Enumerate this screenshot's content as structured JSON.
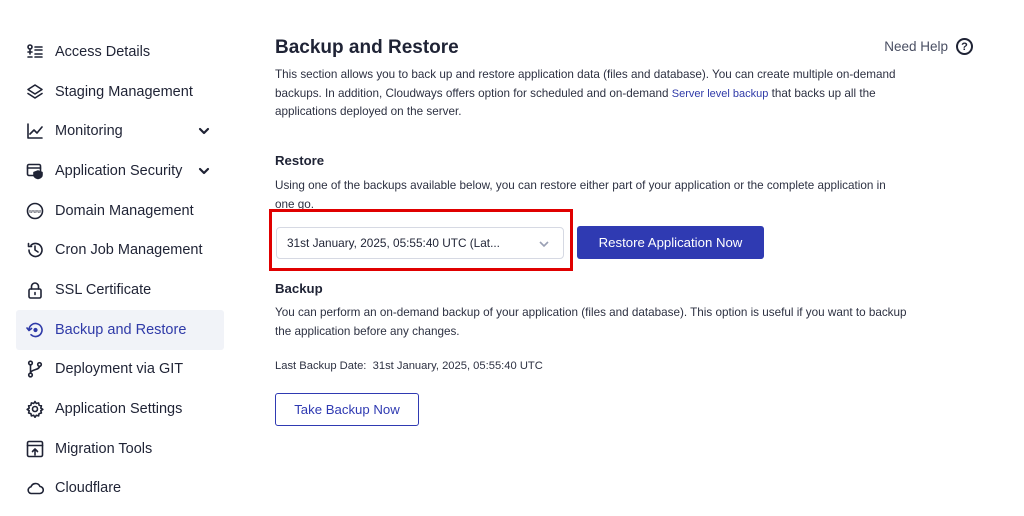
{
  "sidebar": {
    "items": [
      {
        "label": "Access Details",
        "icon": "access-details-icon"
      },
      {
        "label": "Staging Management",
        "icon": "layers-icon"
      },
      {
        "label": "Monitoring",
        "icon": "chart-line-icon",
        "has_chevron": true
      },
      {
        "label": "Application Security",
        "icon": "shield-window-icon",
        "has_chevron": true
      },
      {
        "label": "Domain Management",
        "icon": "www-icon"
      },
      {
        "label": "Cron Job Management",
        "icon": "history-clock-icon"
      },
      {
        "label": "SSL Certificate",
        "icon": "lock-icon"
      },
      {
        "label": "Backup and Restore",
        "icon": "backup-restore-icon",
        "active": true
      },
      {
        "label": "Deployment via GIT",
        "icon": "git-branch-icon"
      },
      {
        "label": "Application Settings",
        "icon": "gear-icon"
      },
      {
        "label": "Migration Tools",
        "icon": "migration-icon"
      },
      {
        "label": "Cloudflare",
        "icon": "cloud-icon"
      }
    ]
  },
  "main": {
    "title": "Backup and Restore",
    "help_label": "Need Help",
    "help_icon": "?",
    "intro_text": "This section allows you to back up and restore application data (files and database). You can create multiple on-demand backups. In addition, Cloudways offers option for scheduled and on-demand",
    "intro_link": "Server level backup",
    "intro_text_end": "that backs up all the applications deployed on the server.",
    "restore": {
      "title": "Restore",
      "description": "Using one of the backups available below, you can restore either part of your application or the complete application in one go.",
      "selected_backup": "31st January, 2025, 05:55:40 UTC (Lat...",
      "button_label": "Restore Application Now"
    },
    "backup": {
      "title": "Backup",
      "description": "You can perform an on-demand backup of your application (files and database). This option is useful if you want to backup the application before any changes.",
      "last_backup_label": "Last Backup Date:",
      "last_backup_value": "31st January, 2025, 05:55:40 UTC",
      "button_label": "Take Backup Now"
    }
  },
  "colors": {
    "accent": "#2f3ab2",
    "highlight_border": "#e00000",
    "active_bg": "#f1f3f8"
  }
}
